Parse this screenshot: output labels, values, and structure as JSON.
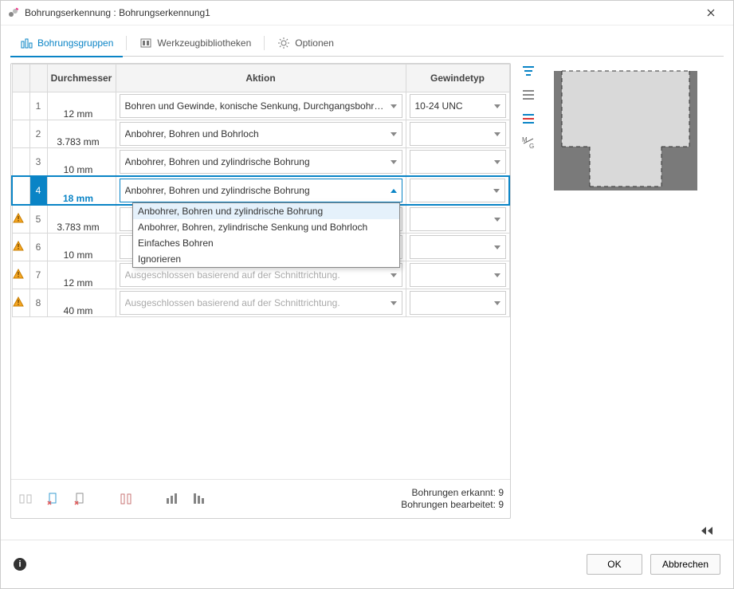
{
  "title": "Bohrungserkennung : Bohrungserkennung1",
  "tabs": {
    "groups": "Bohrungsgruppen",
    "libs": "Werkzeugbibliotheken",
    "options": "Optionen"
  },
  "columns": {
    "diameter": "Durchmesser",
    "action": "Aktion",
    "thread": "Gewindetyp"
  },
  "rows": [
    {
      "idx": "1",
      "warn": false,
      "diameter": "12 mm",
      "action": "Bohren und Gewinde, konische Senkung, Durchgangsbohrung",
      "thread": "10-24 UNC",
      "disabled": false,
      "selected": false,
      "open": false
    },
    {
      "idx": "2",
      "warn": false,
      "diameter": "3.783 mm",
      "action": "Anbohrer, Bohren und Bohrloch",
      "thread": "",
      "disabled": false,
      "selected": false,
      "open": false
    },
    {
      "idx": "3",
      "warn": false,
      "diameter": "10 mm",
      "action": "Anbohrer, Bohren und zylindrische Bohrung",
      "thread": "",
      "disabled": false,
      "selected": false,
      "open": false
    },
    {
      "idx": "4",
      "warn": false,
      "diameter": "18 mm",
      "action": "Anbohrer, Bohren und zylindrische Bohrung",
      "thread": "",
      "disabled": false,
      "selected": true,
      "open": true
    },
    {
      "idx": "5",
      "warn": true,
      "diameter": "3.783 mm",
      "action": "",
      "thread": "",
      "disabled": false,
      "selected": false,
      "open": false
    },
    {
      "idx": "6",
      "warn": true,
      "diameter": "10 mm",
      "action": "",
      "thread": "",
      "disabled": false,
      "selected": false,
      "open": false
    },
    {
      "idx": "7",
      "warn": true,
      "diameter": "12 mm",
      "action": "Ausgeschlossen basierend auf der Schnittrichtung.",
      "thread": "",
      "disabled": true,
      "selected": false,
      "open": false
    },
    {
      "idx": "8",
      "warn": true,
      "diameter": "40 mm",
      "action": "Ausgeschlossen basierend auf der Schnittrichtung.",
      "thread": "",
      "disabled": true,
      "selected": false,
      "open": false
    }
  ],
  "dropdown_options": [
    "Anbohrer, Bohren und zylindrische Bohrung",
    "Anbohrer, Bohren, zylindrische Senkung und Bohrloch",
    "Einfaches Bohren",
    "Ignorieren"
  ],
  "stats": {
    "detected_label": "Bohrungen erkannt:",
    "detected_value": "9",
    "edited_label": "Bohrungen bearbeitet:",
    "edited_value": "9"
  },
  "buttons": {
    "ok": "OK",
    "cancel": "Abbrechen"
  }
}
